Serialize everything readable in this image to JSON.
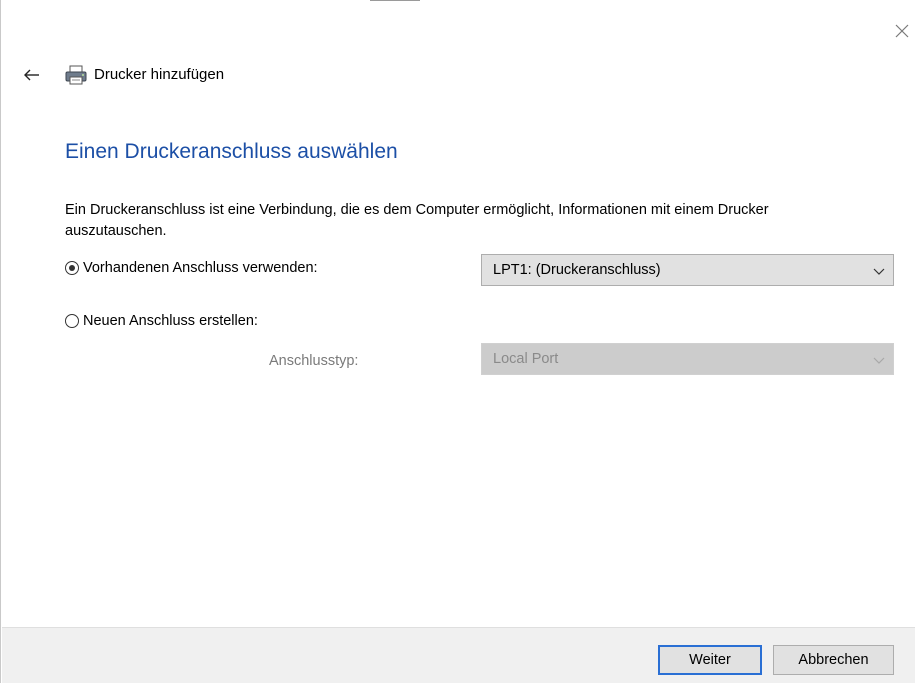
{
  "window": {
    "title": "Drucker hinzufügen",
    "icons": {
      "close": "close-icon",
      "back": "back-arrow-icon",
      "printer": "printer-icon"
    }
  },
  "page": {
    "heading": "Einen Druckeranschluss auswählen",
    "description": "Ein Druckeranschluss ist eine Verbindung, die es dem Computer ermöglicht, Informationen mit einem Drucker auszutauschen."
  },
  "options": {
    "existing_port": {
      "label": "Vorhandenen Anschluss verwenden:",
      "selected": true,
      "dropdown_value": "LPT1: (Druckeranschluss)"
    },
    "new_port": {
      "label": "Neuen Anschluss erstellen:",
      "selected": false,
      "type_label": "Anschlusstyp:",
      "type_value": "Local Port",
      "type_disabled": true
    }
  },
  "footer": {
    "next_label": "Weiter",
    "cancel_label": "Abbrechen"
  },
  "colors": {
    "heading": "#1c4fa6",
    "default_button_border": "#2a6fd4",
    "footer_bg": "#f0f0f0",
    "disabled_text": "#7a7a7a"
  }
}
